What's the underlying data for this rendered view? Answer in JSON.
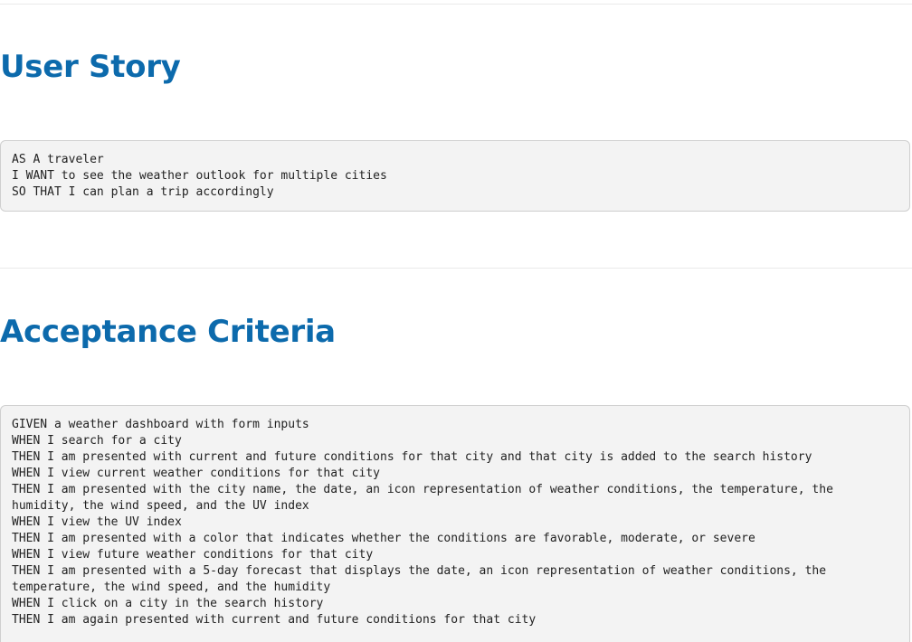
{
  "user_story": {
    "heading": "User Story",
    "lines": [
      "AS A traveler",
      "I WANT to see the weather outlook for multiple cities",
      "SO THAT I can plan a trip accordingly"
    ]
  },
  "acceptance_criteria": {
    "heading": "Acceptance Criteria",
    "lines": [
      "GIVEN a weather dashboard with form inputs",
      "WHEN I search for a city",
      "THEN I am presented with current and future conditions for that city and that city is added to the search history",
      "WHEN I view current weather conditions for that city",
      "THEN I am presented with the city name, the date, an icon representation of weather conditions, the temperature, the",
      "humidity, the wind speed, and the UV index",
      "WHEN I view the UV index",
      "THEN I am presented with a color that indicates whether the conditions are favorable, moderate, or severe",
      "WHEN I view future weather conditions for that city",
      "THEN I am presented with a 5-day forecast that displays the date, an icon representation of weather conditions, the",
      "temperature, the wind speed, and the humidity",
      "WHEN I click on a city in the search history",
      "THEN I am again presented with current and future conditions for that city"
    ]
  }
}
